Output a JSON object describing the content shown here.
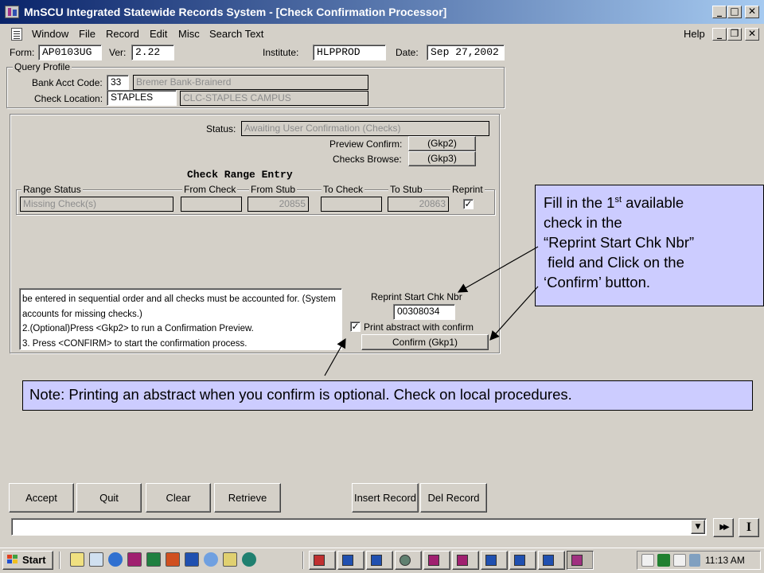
{
  "window": {
    "title": "MnSCU Integrated Statewide Records System - [Check Confirmation Processor]",
    "minimize_glyph": "_",
    "maximize_glyph": "□",
    "close_glyph": "✕",
    "child_minimize_glyph": "_",
    "child_restore_glyph": "❐",
    "child_close_glyph": "✕"
  },
  "menu": {
    "items": [
      "Window",
      "File",
      "Record",
      "Edit",
      "Misc",
      "Search Text"
    ],
    "help": "Help"
  },
  "header": {
    "form_label": "Form:",
    "form_value": "AP0103UG",
    "ver_label": "Ver:",
    "ver_value": "2.22",
    "institute_label": "Institute:",
    "institute_value": "HLPPROD",
    "date_label": "Date:",
    "date_value": "Sep 27,2002"
  },
  "query_profile": {
    "title": "Query Profile",
    "bank_acct_label": "Bank Acct Code:",
    "bank_acct_code": "33",
    "bank_acct_name": "Bremer Bank-Brainerd",
    "check_location_label": "Check Location:",
    "check_location_code": "STAPLES",
    "check_location_name": "CLC-STAPLES CAMPUS"
  },
  "processing": {
    "status_label": "Status:",
    "status_value": "Awaiting User Confirmation (Checks)",
    "preview_confirm_label": "Preview Confirm:",
    "preview_confirm_button": "(Gkp2)",
    "checks_browse_label": "Checks Browse:",
    "checks_browse_button": "(Gkp3)",
    "range_heading": "Check Range Entry",
    "columns": [
      "Range Status",
      "From Check",
      "From Stub",
      "To Check",
      "To Stub",
      "Reprint"
    ],
    "row": {
      "range_status": "Missing Check(s)",
      "from_check": "",
      "from_stub": "20855",
      "to_check": "",
      "to_stub": "20863",
      "reprint_mark": "✓"
    },
    "instructions": [
      "be entered in sequential order and all checks must be accounted for. (System",
      "accounts for missing checks.)",
      "2.(Optional)Press <Gkp2> to run a Confirmation Preview.",
      "3. Press <CONFIRM> to start the confirmation process."
    ],
    "reprint_start_label": "Reprint Start Chk Nbr",
    "reprint_start_value": "00308034",
    "print_abstract_label": "Print abstract with confirm",
    "print_abstract_mark": "✓",
    "confirm_button": "Confirm (Gkp1)"
  },
  "callouts": {
    "right_lines": [
      "Fill in the 1",
      "check in the",
      "“Reprint Start Chk Nbr”",
      " field and Click on the",
      "‘Confirm’ button."
    ],
    "right_superscript": "st",
    "right_line1_suffix": " available",
    "bottom": "Note:  Printing an abstract when you confirm is optional.  Check on local procedures."
  },
  "buttons": {
    "accept": "Accept",
    "quit": "Quit",
    "clear": "Clear",
    "retrieve": "Retrieve",
    "insert_record": "Insert Record",
    "del_record": "Del Record"
  },
  "status_bar": {
    "value": "",
    "dropdown_glyph": "▼",
    "next_glyph": "▶▶",
    "cursor_glyph": "I"
  },
  "taskbar": {
    "start_label": "Start",
    "clock": "11:13 AM",
    "colors": {
      "accent": "#0a246a",
      "callout": "#ccccff"
    }
  }
}
